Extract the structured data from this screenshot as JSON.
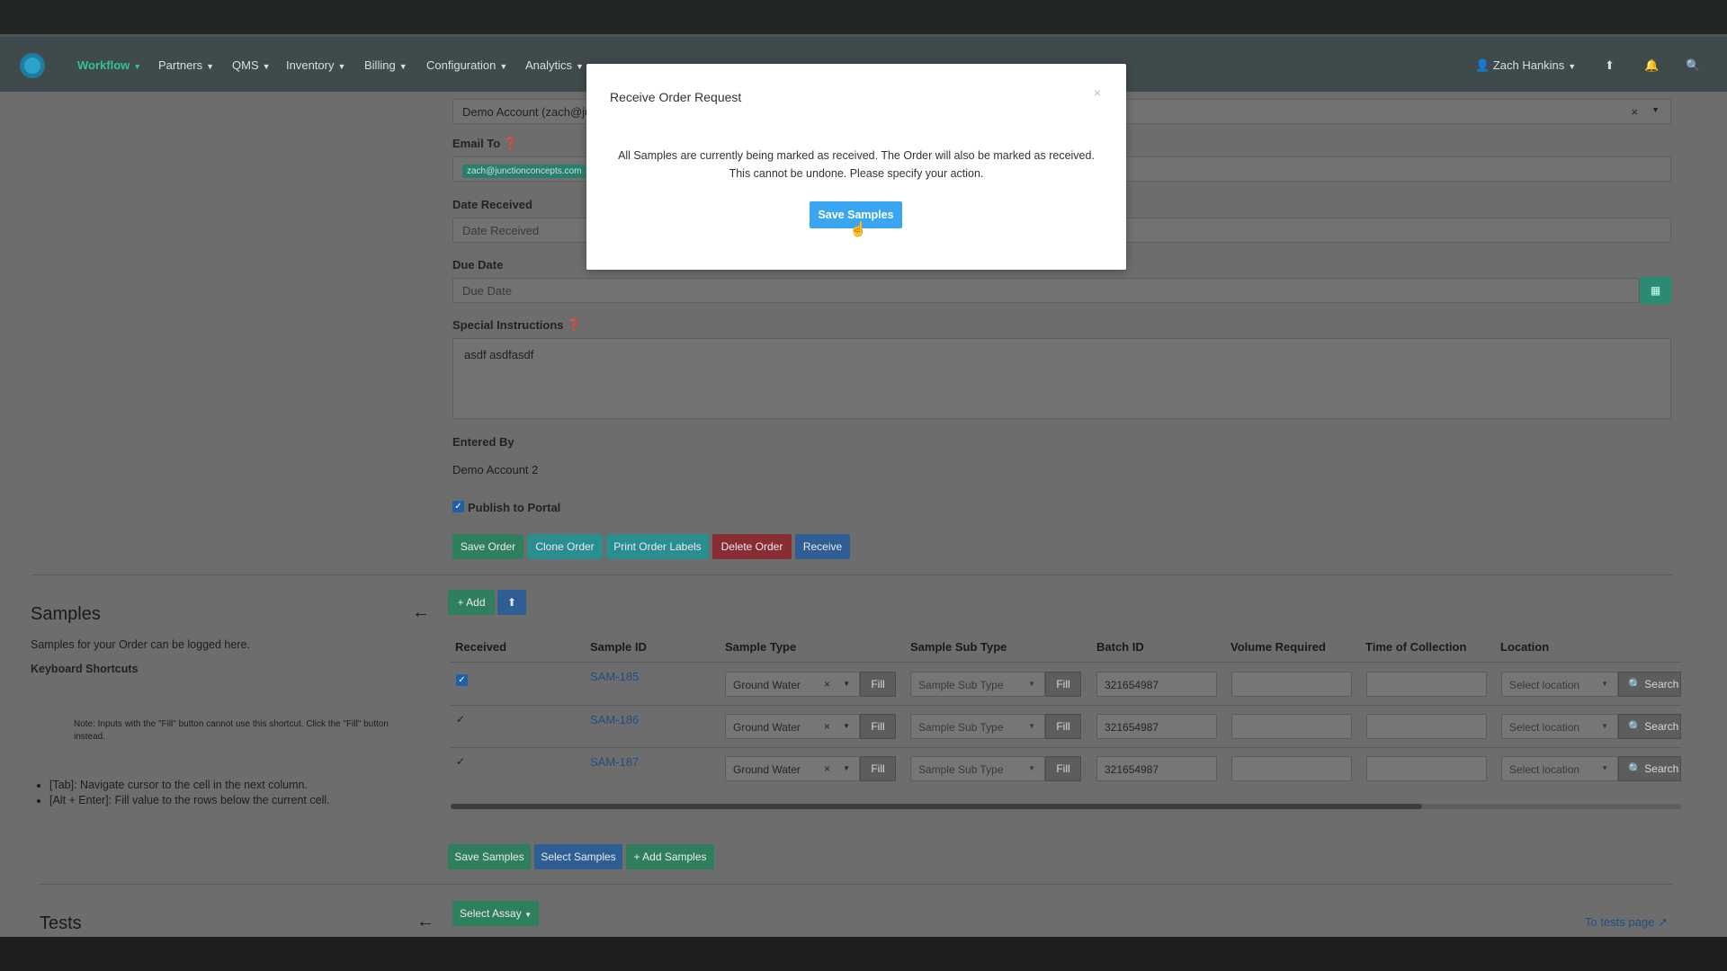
{
  "nav": {
    "items": [
      "Workflow",
      "Partners",
      "QMS",
      "Inventory",
      "Billing",
      "Configuration",
      "Analytics"
    ],
    "user": "Zach Hankins",
    "accent": "#35c196"
  },
  "form": {
    "account_value": "Demo Account (zach@ju",
    "email_to_label": "Email To",
    "email_tag": "zach@junctionconcepts.com",
    "date_received_label": "Date Received",
    "date_received_placeholder": "Date Received",
    "due_date_label": "Due Date",
    "due_date_placeholder": "Due Date",
    "special_instructions_label": "Special Instructions",
    "special_instructions_value": "asdf asdfasdf",
    "entered_by_label": "Entered By",
    "entered_by_value": "Demo Account 2",
    "publish_label": "Publish to Portal",
    "buttons": {
      "save_order": "Save Order",
      "clone_order": "Clone Order",
      "print_labels": "Print Order Labels",
      "delete_order": "Delete Order",
      "receive": "Receive"
    }
  },
  "samples": {
    "title": "Samples",
    "description": "Samples for your Order can be logged here.",
    "shortcuts_title": "Keyboard Shortcuts",
    "shortcut_1": "[Tab]: Navigate cursor to the cell in the next column.",
    "shortcut_2": "[Alt + Enter]: Fill value to the rows below the current cell.",
    "shortcut_note": "Note: Inputs with the \"Fill\" button cannot use this shortcut. Click the \"Fill\" button instead.",
    "add_label": "+ Add",
    "columns": [
      "Received",
      "Sample ID",
      "Sample Type",
      "Sample Sub Type",
      "Batch ID",
      "Volume Required",
      "Time of Collection",
      "Location"
    ],
    "rows": [
      {
        "id": "SAM-185",
        "type": "Ground Water",
        "subtype_placeholder": "Sample Sub Type",
        "batch": "321654987",
        "location_placeholder": "Select location"
      },
      {
        "id": "SAM-186",
        "type": "Ground Water",
        "subtype_placeholder": "Sample Sub Type",
        "batch": "321654987",
        "location_placeholder": "Select location"
      },
      {
        "id": "SAM-187",
        "type": "Ground Water",
        "subtype_placeholder": "Sample Sub Type",
        "batch": "321654987",
        "location_placeholder": "Select location"
      }
    ],
    "fill_label": "Fill",
    "search_label": "Search",
    "footer_buttons": {
      "save_samples": "Save Samples",
      "select_samples": "Select Samples",
      "add_samples": "+ Add Samples"
    }
  },
  "tests": {
    "title": "Tests",
    "select_assay": "Select Assay",
    "tests_page_link": "To tests page"
  },
  "modal": {
    "title": "Receive Order Request",
    "close": "×",
    "body_line1": "All Samples are currently being marked as received. The Order will also be marked as received.",
    "body_line2": "This cannot be undone. Please specify your action.",
    "button": "Save Samples"
  }
}
